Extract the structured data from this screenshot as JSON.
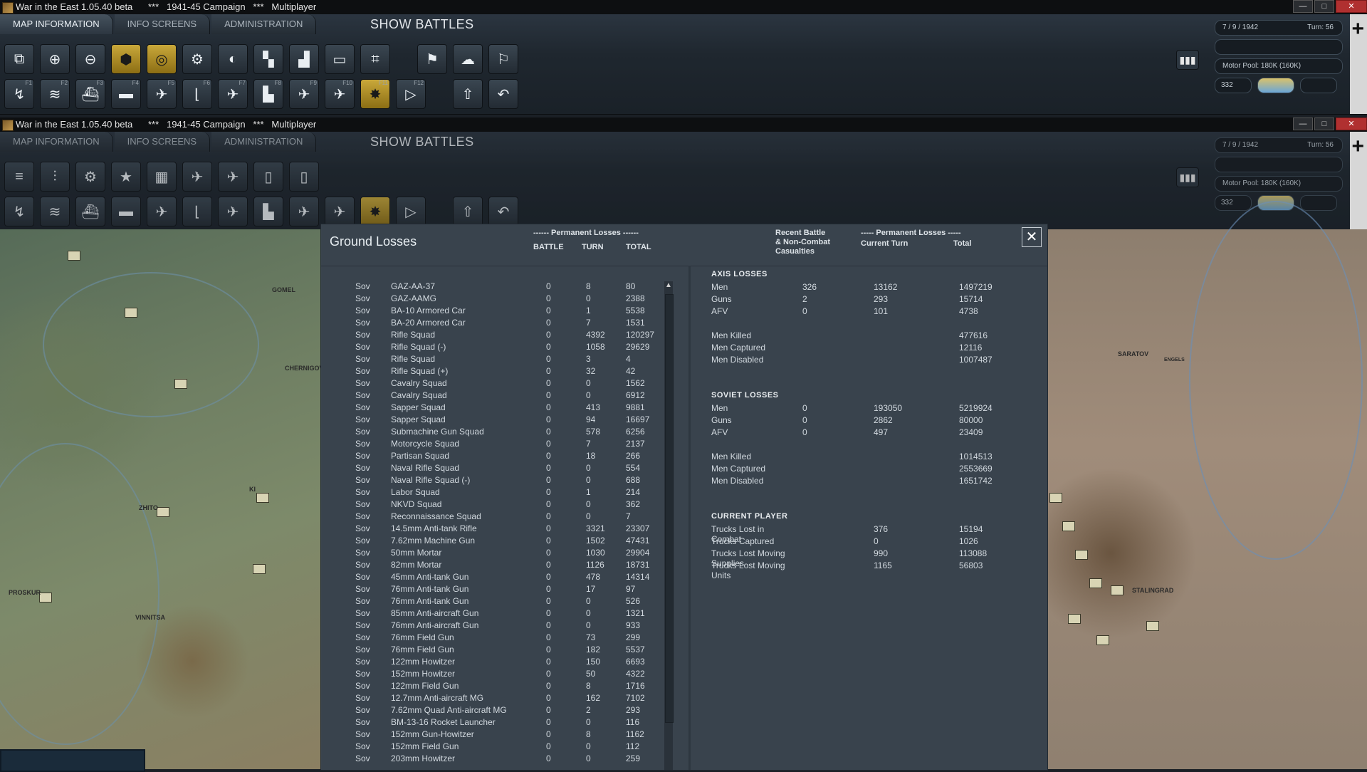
{
  "window": {
    "title": "War in the East 1.05.40 beta      ***   1941-45 Campaign   ***   Multiplayer"
  },
  "top_bar": {
    "tabs": [
      "MAP INFORMATION",
      "INFO SCREENS",
      "ADMINISTRATION"
    ],
    "show_battles": "SHOW BATTLES",
    "date": "7 / 9 / 1942",
    "turn": "Turn: 56",
    "motor_pool": "Motor Pool: 180K (160K)",
    "small_value": "332",
    "row1_icons": [
      "window-icon",
      "zoom-in-icon",
      "zoom-out-icon",
      "hex-icon",
      "target-icon",
      "gear-icon",
      "supply-icon",
      "chart-icon",
      "industry-icon",
      "frame-icon",
      "camera-icon",
      "flag-exit-icon",
      "weather-icon",
      "flag-icon"
    ],
    "row2_icons": [
      {
        "name": "f1-icon",
        "key": "F1"
      },
      {
        "name": "f2-icon",
        "key": "F2"
      },
      {
        "name": "f3-icon",
        "key": "F3"
      },
      {
        "name": "f4-icon",
        "key": "F4"
      },
      {
        "name": "f5-icon",
        "key": "F5"
      },
      {
        "name": "f6-icon",
        "key": "F6"
      },
      {
        "name": "f7-icon",
        "key": "F7"
      },
      {
        "name": "f8-icon",
        "key": "F8"
      },
      {
        "name": "f9-icon",
        "key": "F9"
      },
      {
        "name": "f10-icon",
        "key": "F10"
      },
      {
        "name": "f11-battle-icon",
        "key": "F11"
      },
      {
        "name": "f12-play-icon",
        "key": "F12"
      }
    ]
  },
  "dialog": {
    "title": "Ground Losses",
    "perm_losses_header": "------ Permanent Losses ------",
    "col_battle": "BATTLE",
    "col_turn": "TURN",
    "col_total": "TOTAL",
    "recent_header": "Recent Battle\n& Non-Combat\nCasualties",
    "perm_losses_header2": "----- Permanent Losses -----",
    "current_turn": "Current Turn",
    "total": "Total",
    "rows": [
      [
        "Sov",
        "GAZ-AA-37",
        "0",
        "8",
        "80"
      ],
      [
        "Sov",
        "GAZ-AAMG",
        "0",
        "0",
        "2388"
      ],
      [
        "Sov",
        "BA-10 Armored Car",
        "0",
        "1",
        "5538"
      ],
      [
        "Sov",
        "BA-20 Armored Car",
        "0",
        "7",
        "1531"
      ],
      [
        "Sov",
        "Rifle Squad",
        "0",
        "4392",
        "120297"
      ],
      [
        "Sov",
        "Rifle Squad (-)",
        "0",
        "1058",
        "29629"
      ],
      [
        "Sov",
        "Rifle Squad",
        "0",
        "3",
        "4"
      ],
      [
        "Sov",
        "Rifle Squad (+)",
        "0",
        "32",
        "42"
      ],
      [
        "Sov",
        "Cavalry Squad",
        "0",
        "0",
        "1562"
      ],
      [
        "Sov",
        "Cavalry Squad",
        "0",
        "0",
        "6912"
      ],
      [
        "Sov",
        "Sapper Squad",
        "0",
        "413",
        "9881"
      ],
      [
        "Sov",
        "Sapper Squad",
        "0",
        "94",
        "16697"
      ],
      [
        "Sov",
        "Submachine Gun Squad",
        "0",
        "578",
        "6256"
      ],
      [
        "Sov",
        "Motorcycle Squad",
        "0",
        "7",
        "2137"
      ],
      [
        "Sov",
        "Partisan Squad",
        "0",
        "18",
        "266"
      ],
      [
        "Sov",
        "Naval Rifle Squad",
        "0",
        "0",
        "554"
      ],
      [
        "Sov",
        "Naval Rifle Squad (-)",
        "0",
        "0",
        "688"
      ],
      [
        "Sov",
        "Labor Squad",
        "0",
        "1",
        "214"
      ],
      [
        "Sov",
        "NKVD Squad",
        "0",
        "0",
        "362"
      ],
      [
        "Sov",
        "Reconnaissance Squad",
        "0",
        "0",
        "7"
      ],
      [
        "Sov",
        "14.5mm Anti-tank Rifle",
        "0",
        "3321",
        "23307"
      ],
      [
        "Sov",
        "7.62mm Machine Gun",
        "0",
        "1502",
        "47431"
      ],
      [
        "Sov",
        "50mm Mortar",
        "0",
        "1030",
        "29904"
      ],
      [
        "Sov",
        "82mm Mortar",
        "0",
        "1126",
        "18731"
      ],
      [
        "Sov",
        "45mm Anti-tank Gun",
        "0",
        "478",
        "14314"
      ],
      [
        "Sov",
        "76mm Anti-tank Gun",
        "0",
        "17",
        "97"
      ],
      [
        "Sov",
        "76mm Anti-tank Gun",
        "0",
        "0",
        "526"
      ],
      [
        "Sov",
        "85mm Anti-aircraft Gun",
        "0",
        "0",
        "1321"
      ],
      [
        "Sov",
        "76mm Anti-aircraft Gun",
        "0",
        "0",
        "933"
      ],
      [
        "Sov",
        "76mm Field Gun",
        "0",
        "73",
        "299"
      ],
      [
        "Sov",
        "76mm Field Gun",
        "0",
        "182",
        "5537"
      ],
      [
        "Sov",
        "122mm Howitzer",
        "0",
        "150",
        "6693"
      ],
      [
        "Sov",
        "152mm Howitzer",
        "0",
        "50",
        "4322"
      ],
      [
        "Sov",
        "122mm Field Gun",
        "0",
        "8",
        "1716"
      ],
      [
        "Sov",
        "12.7mm Anti-aircraft MG",
        "0",
        "162",
        "7102"
      ],
      [
        "Sov",
        "7.62mm Quad Anti-aircraft MG",
        "0",
        "2",
        "293"
      ],
      [
        "Sov",
        "BM-13-16 Rocket Launcher",
        "0",
        "0",
        "116"
      ],
      [
        "Sov",
        "152mm Gun-Howitzer",
        "0",
        "8",
        "1162"
      ],
      [
        "Sov",
        "152mm Field Gun",
        "0",
        "0",
        "112"
      ],
      [
        "Sov",
        "203mm Howitzer",
        "0",
        "0",
        "259"
      ]
    ],
    "axis": {
      "title": "AXIS LOSSES",
      "rows": [
        [
          "Men",
          "326",
          "13162",
          "1497219"
        ],
        [
          "Guns",
          "2",
          "293",
          "15714"
        ],
        [
          "AFV",
          "0",
          "101",
          "4738"
        ]
      ],
      "rows2": [
        [
          "Men Killed",
          "",
          "",
          "477616"
        ],
        [
          "Men Captured",
          "",
          "",
          "12116"
        ],
        [
          "Men Disabled",
          "",
          "",
          "1007487"
        ]
      ]
    },
    "soviet": {
      "title": "SOVIET LOSSES",
      "rows": [
        [
          "Men",
          "0",
          "193050",
          "5219924"
        ],
        [
          "Guns",
          "0",
          "2862",
          "80000"
        ],
        [
          "AFV",
          "0",
          "497",
          "23409"
        ]
      ],
      "rows2": [
        [
          "Men Killed",
          "",
          "",
          "1014513"
        ],
        [
          "Men Captured",
          "",
          "",
          "2553669"
        ],
        [
          "Men Disabled",
          "",
          "",
          "1651742"
        ]
      ]
    },
    "player": {
      "title": "CURRENT PLAYER",
      "rows": [
        [
          "Trucks Lost in Combat",
          "",
          "376",
          "15194"
        ],
        [
          "Trucks Captured",
          "",
          "0",
          "1026"
        ],
        [
          "Trucks Lost Moving Supplies",
          "",
          "990",
          "113088"
        ],
        [
          "Trucks Lost Moving Units",
          "",
          "1165",
          "56803"
        ]
      ]
    }
  },
  "map_labels": [
    "GOMEL",
    "CHERNIGOV",
    "KI",
    "ZHITO",
    "PROSKUR",
    "VINNITSA",
    "SARATOV",
    "ENGELS",
    "STALINGRAD"
  ]
}
